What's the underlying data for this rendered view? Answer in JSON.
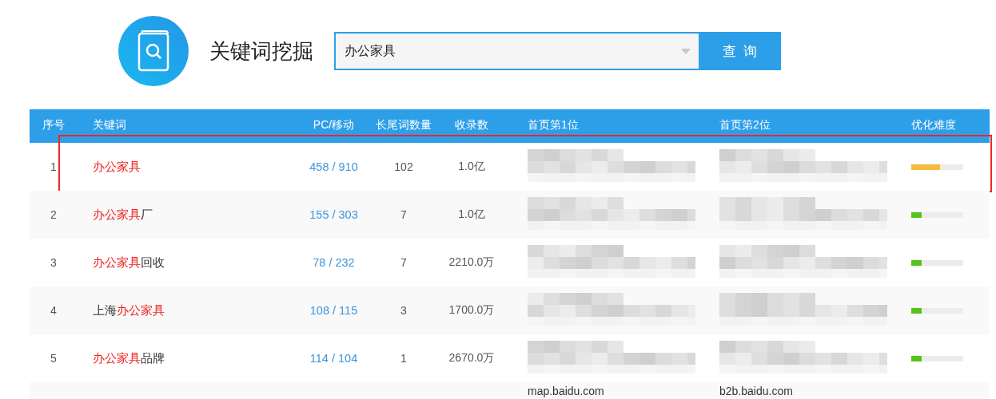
{
  "header": {
    "title": "关键词挖掘",
    "search": {
      "value": "办公家具"
    },
    "button": "查 询"
  },
  "table": {
    "columns": [
      "序号",
      "关键词",
      "PC/移动",
      "长尾词数量",
      "收录数",
      "首页第1位",
      "首页第2位",
      "优化难度"
    ],
    "rows": [
      {
        "index": "1",
        "keyword": [
          {
            "text": "办公家具",
            "match": true
          }
        ],
        "pc_mobile": "458 / 910",
        "long_tail": "102",
        "indexed": "1.0亿",
        "rank_1": {
          "kind": "blurred"
        },
        "rank_2": {
          "kind": "blurred"
        },
        "difficulty": {
          "level": 0.55,
          "color": "#f5bb3c"
        },
        "highlighted": true
      },
      {
        "index": "2",
        "keyword": [
          {
            "text": "办公家具",
            "match": true
          },
          {
            "text": "厂",
            "match": false
          }
        ],
        "pc_mobile": "155 / 303",
        "long_tail": "7",
        "indexed": "1.0亿",
        "rank_1": {
          "kind": "blurred"
        },
        "rank_2": {
          "kind": "blurred"
        },
        "difficulty": {
          "level": 0.2,
          "color": "#52c41a"
        },
        "highlighted": false
      },
      {
        "index": "3",
        "keyword": [
          {
            "text": "办公家具",
            "match": true
          },
          {
            "text": "回收",
            "match": false
          }
        ],
        "pc_mobile": "78 / 232",
        "long_tail": "7",
        "indexed": "2210.0万",
        "rank_1": {
          "kind": "blurred"
        },
        "rank_2": {
          "kind": "blurred"
        },
        "difficulty": {
          "level": 0.2,
          "color": "#52c41a"
        },
        "highlighted": false
      },
      {
        "index": "4",
        "keyword": [
          {
            "text": "上海",
            "match": false
          },
          {
            "text": "办公家具",
            "match": true
          }
        ],
        "pc_mobile": "108 / 115",
        "long_tail": "3",
        "indexed": "1700.0万",
        "rank_1": {
          "kind": "blurred"
        },
        "rank_2": {
          "kind": "blurred"
        },
        "difficulty": {
          "level": 0.2,
          "color": "#52c41a"
        },
        "highlighted": false
      },
      {
        "index": "5",
        "keyword": [
          {
            "text": "办公家具",
            "match": true
          },
          {
            "text": "品牌",
            "match": false
          }
        ],
        "pc_mobile": "114 / 104",
        "long_tail": "1",
        "indexed": "2670.0万",
        "rank_1": {
          "kind": "blurred"
        },
        "rank_2": {
          "kind": "blurred"
        },
        "difficulty": {
          "level": 0.2,
          "color": "#52c41a"
        },
        "highlighted": false
      },
      {
        "rank_1": {
          "kind": "text",
          "text": "map.baidu.com"
        },
        "rank_2": {
          "kind": "text",
          "text": "b2b.baidu.com"
        }
      }
    ]
  }
}
